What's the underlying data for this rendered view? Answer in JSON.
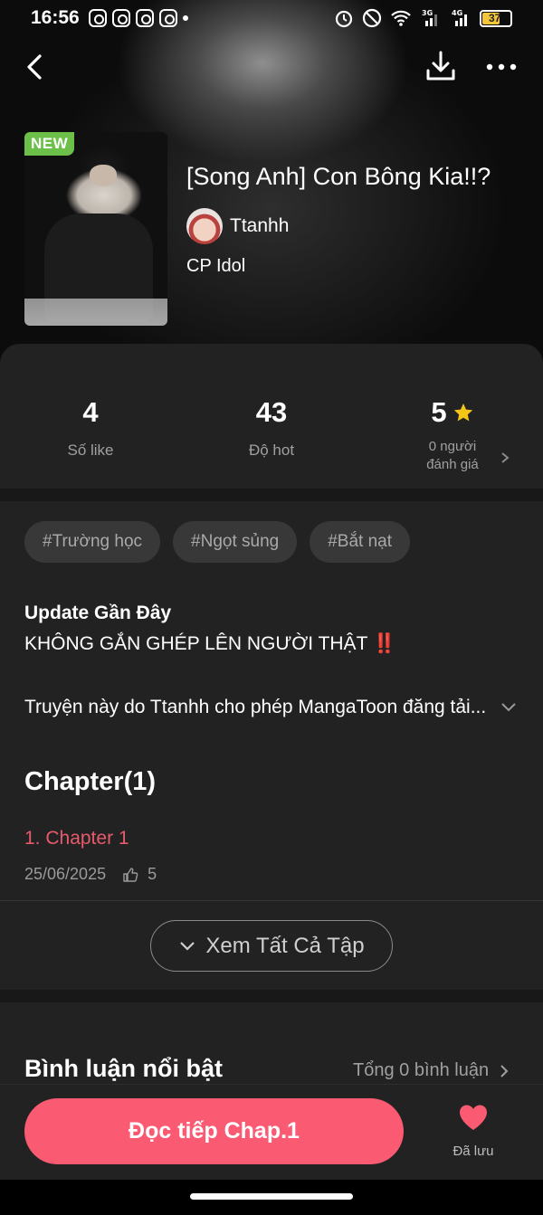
{
  "status_bar": {
    "time": "16:56",
    "battery": "37",
    "signal_labels": [
      "3G",
      "4G"
    ]
  },
  "book": {
    "badge": "NEW",
    "title": "[Song Anh] Con Bông Kia!!?",
    "author": "Ttanhh",
    "category": "CP Idol"
  },
  "stats": {
    "likes_value": "4",
    "likes_label": "Số like",
    "hot_value": "43",
    "hot_label": "Độ hot",
    "rating_value": "5",
    "rating_label_1": "0 người",
    "rating_label_2": "đánh giá"
  },
  "tags": [
    "#Trường học",
    "#Ngọt sủng",
    "#Bắt nạt"
  ],
  "update": {
    "title": "Update Gần Đây",
    "body": "KHÔNG GẮN GHÉP LÊN NGƯỜI THẬT",
    "emoji": "‼️",
    "description": "Truyện này do Ttanhh cho phép MangaToon đăng tải..."
  },
  "chapters": {
    "heading": "Chapter(1)",
    "items": [
      {
        "title": "1. Chapter 1",
        "date": "25/06/2025",
        "likes": "5"
      }
    ],
    "see_all": "Xem Tất Cả Tập"
  },
  "comments": {
    "title": "Bình luận nổi bật",
    "total": "Tổng 0 bình luận"
  },
  "bottom": {
    "read_button": "Đọc tiếp Chap.1",
    "saved_label": "Đã lưu"
  },
  "colors": {
    "accent": "#fb5a73",
    "chapter_link": "#e85a6c",
    "new_badge": "#6cc04a",
    "star": "#f5c518"
  }
}
